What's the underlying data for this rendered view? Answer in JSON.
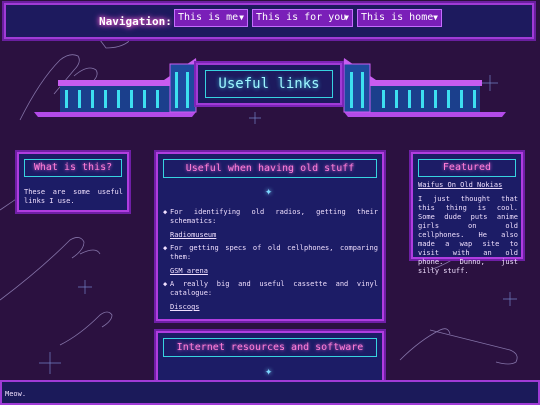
{
  "nav": {
    "label": "Navigation:",
    "selects": [
      {
        "value": "This is me"
      },
      {
        "value": "This is for you"
      },
      {
        "value": "This is home"
      }
    ]
  },
  "banner": {
    "title": "Useful links"
  },
  "what": {
    "heading": "What is this?",
    "text": "These are some useful links I use."
  },
  "useful": {
    "heading": "Useful when having old stuff",
    "items": [
      {
        "text": "For identifying old radios, getting their schematics:",
        "link": "Radiomuseum"
      },
      {
        "text": "For getting specs of old cellphones, comparing them:",
        "link": "GSM arena"
      },
      {
        "text": "A really big and useful cassette and vinyl catalogue:",
        "link": "Discogs"
      }
    ]
  },
  "featured": {
    "heading": "Featured",
    "link": "Waifus On Old Nokias",
    "text": "I just thought that this thing is cool. Some dude puts anime girls on old cellphones. He also made a wap site to visit with an old phone. Dunno, just silly stuff."
  },
  "internet": {
    "heading": "Internet resources and software"
  },
  "footer": {
    "text": "Meow."
  },
  "colors": {
    "bg": "#2b1140",
    "panel": "#1c1c66",
    "border": "#b03de0",
    "cyan": "#37d3e0",
    "pink": "#ff80d8"
  }
}
